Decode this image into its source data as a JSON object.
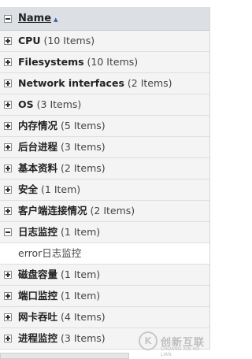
{
  "header": {
    "label": "Name",
    "sort_icon": "sort-ascending-icon"
  },
  "rows": [
    {
      "name": "CPU",
      "count": "(10 Items)",
      "expanded": false
    },
    {
      "name": "Filesystems",
      "count": "(10 Items)",
      "expanded": false
    },
    {
      "name": "Network interfaces",
      "count": "(2 Items)",
      "expanded": false
    },
    {
      "name": "OS",
      "count": "(3 Items)",
      "expanded": false
    },
    {
      "name": "内存情况",
      "count": "(5 Items)",
      "expanded": false
    },
    {
      "name": "后台进程",
      "count": "(3 Items)",
      "expanded": false
    },
    {
      "name": "基本资料",
      "count": "(2 Items)",
      "expanded": false
    },
    {
      "name": "安全",
      "count": "(1 Item)",
      "expanded": false
    },
    {
      "name": "客户端连接情况",
      "count": "(2 Items)",
      "expanded": false
    },
    {
      "name": "日志监控",
      "count": "(1 Item)",
      "expanded": true
    },
    {
      "leaf": "error日志监控"
    },
    {
      "name": "磁盘容量",
      "count": "(1 Item)",
      "expanded": false
    },
    {
      "name": "端口监控",
      "count": "(1 Item)",
      "expanded": false
    },
    {
      "name": "网卡吞吐",
      "count": "(4 Items)",
      "expanded": false
    },
    {
      "name": "进程监控",
      "count": "(3 Items)",
      "expanded": false
    }
  ],
  "watermark": {
    "mark": "K",
    "text": "创新互联",
    "sub": "CHUANG XIN HU LIAN"
  }
}
